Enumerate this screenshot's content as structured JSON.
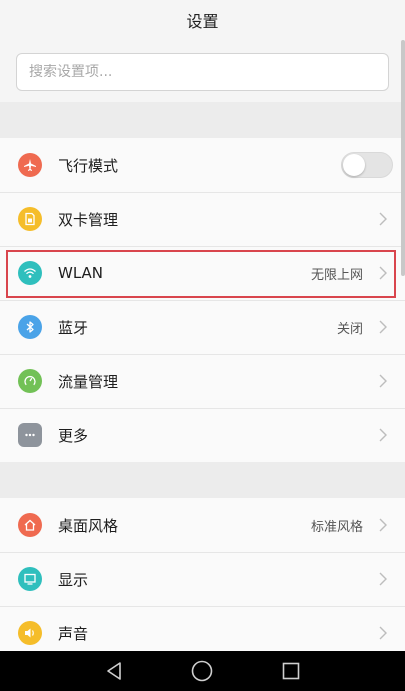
{
  "header": {
    "title": "设置"
  },
  "search": {
    "placeholder": "搜索设置项..."
  },
  "group1": {
    "items": [
      {
        "label": "飞行模式",
        "icon": "airplane-icon",
        "color": "#ef6a50",
        "toggle": false
      },
      {
        "label": "双卡管理",
        "icon": "sim-card-icon",
        "color": "#f5bd2a"
      },
      {
        "label": "WLAN",
        "icon": "wifi-icon",
        "color": "#2fbfbd",
        "value": "无限上网"
      },
      {
        "label": "蓝牙",
        "icon": "bluetooth-icon",
        "color": "#4aa3e8",
        "value": "关闭"
      },
      {
        "label": "流量管理",
        "icon": "data-usage-icon",
        "color": "#72c156"
      },
      {
        "label": "更多",
        "icon": "more-icon",
        "color": "#8e949c"
      }
    ]
  },
  "group2": {
    "items": [
      {
        "label": "桌面风格",
        "icon": "home-icon",
        "color": "#ef6a50",
        "value": "标准风格"
      },
      {
        "label": "显示",
        "icon": "display-icon",
        "color": "#2fbfbd"
      },
      {
        "label": "声音",
        "icon": "sound-icon",
        "color": "#f5bd2a"
      }
    ]
  },
  "highlight_color": "#d9454d",
  "navbar": {
    "icons": [
      "back-icon",
      "home-nav-icon",
      "recents-icon"
    ]
  }
}
